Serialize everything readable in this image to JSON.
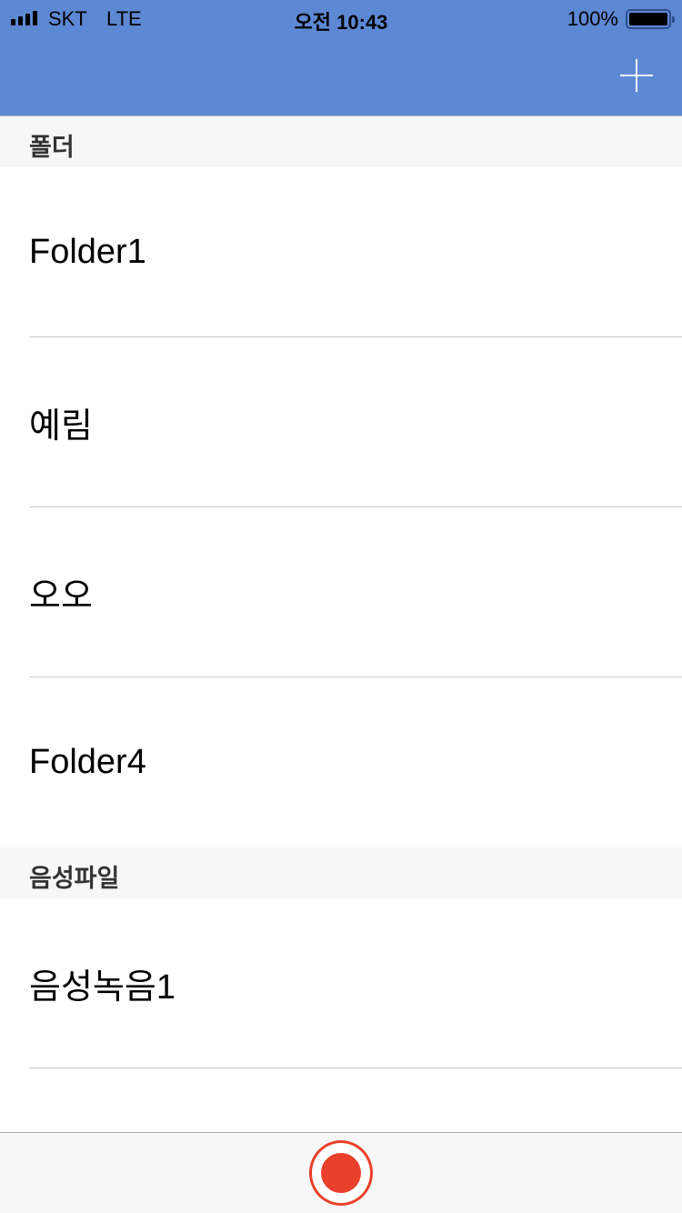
{
  "status": {
    "carrier": "SKT",
    "network": "LTE",
    "time": "오전 10:43",
    "battery": "100%",
    "battery_level": 100
  },
  "colors": {
    "nav": "#5d88d4",
    "record": "#e8402a"
  },
  "sections": [
    {
      "title": "폴더",
      "items": [
        "Folder1",
        "예림",
        "오오",
        "Folder4"
      ]
    },
    {
      "title": "음성파일",
      "items": [
        "음성녹음1"
      ]
    }
  ]
}
